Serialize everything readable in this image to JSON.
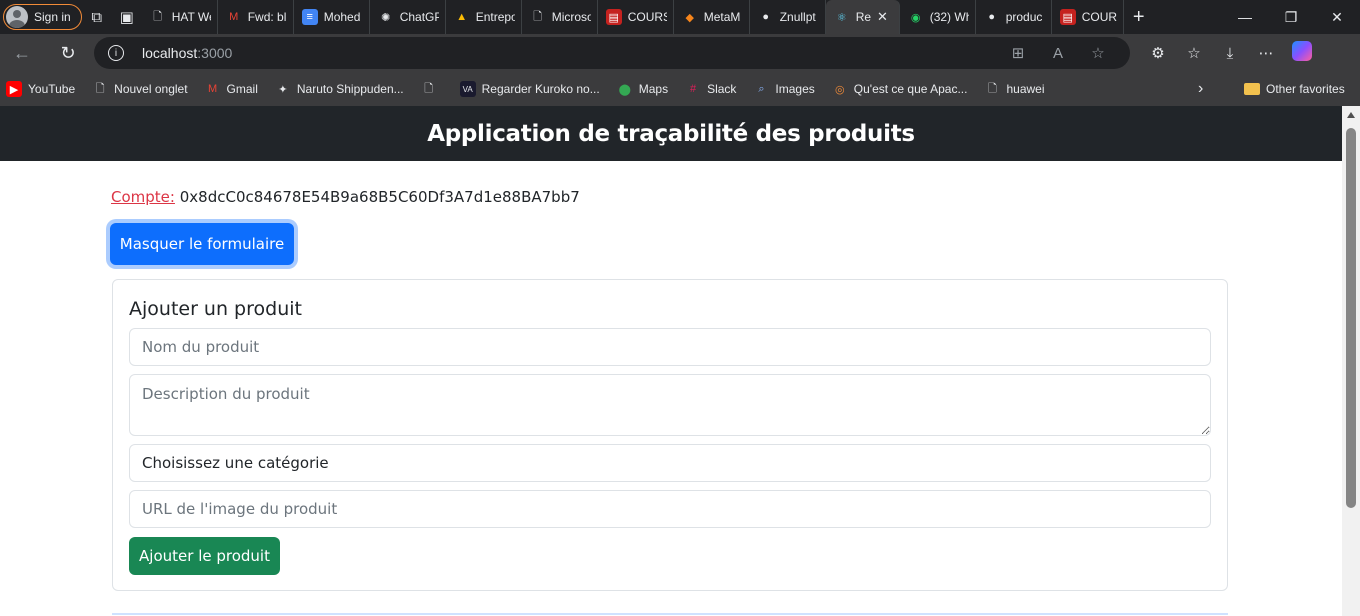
{
  "browser": {
    "signin_label": "Sign in",
    "tabs": [
      {
        "title": "HAT We",
        "icon": "page-icon",
        "active": false
      },
      {
        "title": "Fwd: bl",
        "icon": "gmail-icon",
        "active": false
      },
      {
        "title": "Mohed",
        "icon": "docs-icon",
        "active": false
      },
      {
        "title": "ChatGP",
        "icon": "chatgpt-icon",
        "active": false
      },
      {
        "title": "Entrepo",
        "icon": "drive-icon",
        "active": false
      },
      {
        "title": "Microso",
        "icon": "page-icon",
        "active": false
      },
      {
        "title": "COURS",
        "icon": "pdf-icon",
        "active": false
      },
      {
        "title": "MetaM",
        "icon": "metamask-icon",
        "active": false
      },
      {
        "title": "Znullpt",
        "icon": "github-icon",
        "active": false
      },
      {
        "title": "Re",
        "icon": "react-icon",
        "active": true
      },
      {
        "title": "(32) Wh",
        "icon": "whatsapp-icon",
        "active": false
      },
      {
        "title": "produc",
        "icon": "github-icon",
        "active": false
      },
      {
        "title": "COURS",
        "icon": "pdf-icon",
        "active": false
      }
    ],
    "url_host": "localhost",
    "url_port": ":3000",
    "favorites": [
      {
        "label": "YouTube",
        "icon": "youtube-icon"
      },
      {
        "label": "Nouvel onglet",
        "icon": "page-icon"
      },
      {
        "label": "Gmail",
        "icon": "gmail-icon"
      },
      {
        "label": "Naruto Shippuden...",
        "icon": "naruto-icon"
      },
      {
        "label": "",
        "icon": "page-icon"
      },
      {
        "label": "Regarder Kuroko no...",
        "icon": "va-icon"
      },
      {
        "label": "Maps",
        "icon": "maps-icon"
      },
      {
        "label": "Slack",
        "icon": "slack-icon"
      },
      {
        "label": "Images",
        "icon": "search-icon"
      },
      {
        "label": "Qu'est ce que Apac...",
        "icon": "apache-icon"
      },
      {
        "label": "huawei",
        "icon": "page-icon"
      }
    ],
    "other_favorites": "Other favorites"
  },
  "app": {
    "title": "Application de traçabilité des produits",
    "account_label": "Compte:",
    "account_address": "0x8dcC0c84678E54B9a68B5C60Df3A7d1e88BA7bb7",
    "toggle_button": "Masquer le formulaire",
    "form": {
      "title": "Ajouter un produit",
      "name_placeholder": "Nom du produit",
      "description_placeholder": "Description du produit",
      "category_value": "Choisissez une catégorie",
      "image_placeholder": "URL de l'image du produit",
      "submit_label": "Ajouter le produit"
    }
  }
}
